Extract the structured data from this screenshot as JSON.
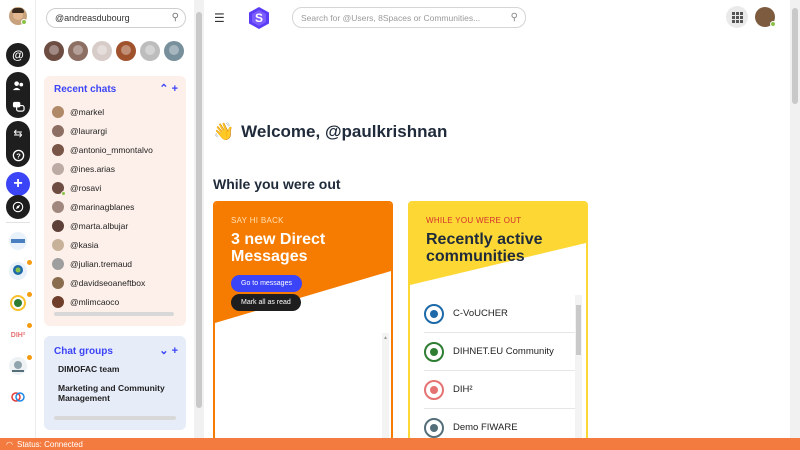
{
  "sidebar": {
    "current_user_search": "@andreasdubourg",
    "recent_chats": {
      "title": "Recent chats",
      "collapse_icon": "chevron-up-icon",
      "add_icon": "plus-icon",
      "items": [
        {
          "name": "@markel",
          "color": "#b08968",
          "online": false
        },
        {
          "name": "@laurargi",
          "color": "#8d6e63",
          "online": false
        },
        {
          "name": "@antonio_mmontalvo",
          "color": "#795548",
          "online": false
        },
        {
          "name": "@ines.arias",
          "color": "#bcaaa4",
          "online": false
        },
        {
          "name": "@rosavi",
          "color": "#6d4c41",
          "online": true
        },
        {
          "name": "@marinagblanes",
          "color": "#a1887f",
          "online": false
        },
        {
          "name": "@marta.albujar",
          "color": "#5d4037",
          "online": false
        },
        {
          "name": "@kasia",
          "color": "#c7b299",
          "online": false
        },
        {
          "name": "@julian.tremaud",
          "color": "#9e9e9e",
          "online": false
        },
        {
          "name": "@davidseoaneftbox",
          "color": "#8a6d4e",
          "online": false
        },
        {
          "name": "@mlimcaoco",
          "color": "#6f3f2c",
          "online": false
        }
      ]
    },
    "chat_groups": {
      "title": "Chat groups",
      "collapse_icon": "chevron-down-icon",
      "add_icon": "plus-icon",
      "items": [
        "DIMOFAC team",
        "Marketing and Community Management"
      ]
    }
  },
  "topbar": {
    "search_placeholder": "Search for @Users, 8Spaces or Communities...",
    "apps_icon": "grid-icon"
  },
  "main": {
    "welcome": "Welcome, @paulkrishnan",
    "section_title": "While you were out",
    "dm_card": {
      "kicker": "SAY HI BACK",
      "headline": "3 new Direct Messages",
      "go_button": "Go to messages",
      "mark_button": "Mark all as read",
      "accent": "#f57c00"
    },
    "communities_card": {
      "kicker": "WHILE YOU WERE OUT",
      "headline": "Recently active communities",
      "accent": "#fdd835",
      "items": [
        {
          "name": "C-VoUCHER",
          "color": "#1e6aa8"
        },
        {
          "name": "DIHNET.EU Community",
          "color": "#2e7d32"
        },
        {
          "name": "DIH²",
          "color": "#e57373"
        },
        {
          "name": "Demo FIWARE",
          "color": "#546e7a"
        }
      ]
    }
  },
  "status": {
    "text": "Status: Connected",
    "color": "#f47b3f"
  }
}
